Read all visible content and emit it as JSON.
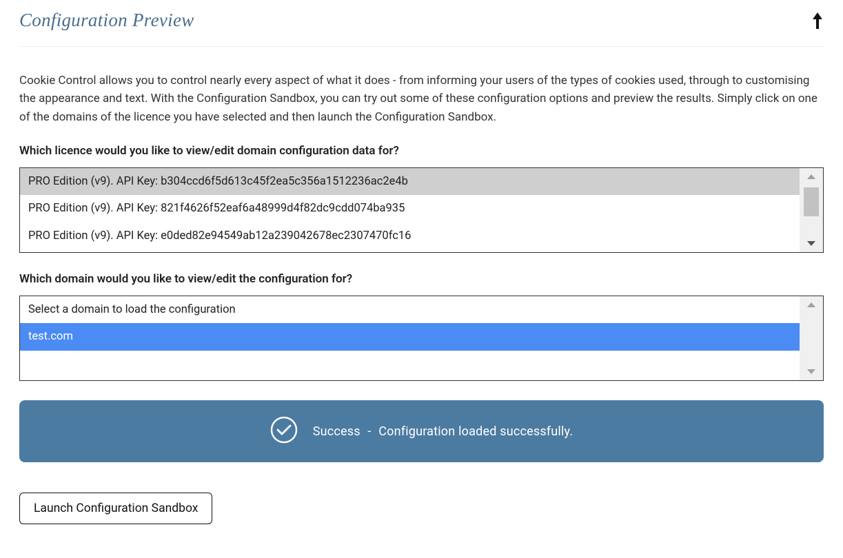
{
  "header": {
    "title": "Configuration Preview"
  },
  "intro": "Cookie Control allows you to control nearly every aspect of what it does - from informing your users of the types of cookies used, through to customising the appearance and text. With the Configuration Sandbox, you can try out some of these configuration options and preview the results. Simply click on one of the domains of the licence you have selected and then launch the Configuration Sandbox.",
  "licence": {
    "label": "Which licence would you like to view/edit domain configuration data for?",
    "items": [
      "PRO Edition (v9). API Key: b304ccd6f5d613c45f2ea5c356a1512236ac2e4b",
      "PRO Edition (v9). API Key: 821f4626f52eaf6a48999d4f82dc9cdd074ba935",
      "PRO Edition (v9). API Key: e0ded82e94549ab12a239042678ec2307470fc16"
    ],
    "selected_index": 0
  },
  "domain": {
    "label": "Which domain would you like to view/edit the configuration for?",
    "items": [
      "Select a domain to load the configuration",
      "test.com"
    ],
    "selected_index": 1
  },
  "status": {
    "title": "Success",
    "separator": "-",
    "message": "Configuration loaded successfully."
  },
  "actions": {
    "launch_label": "Launch Configuration Sandbox"
  }
}
